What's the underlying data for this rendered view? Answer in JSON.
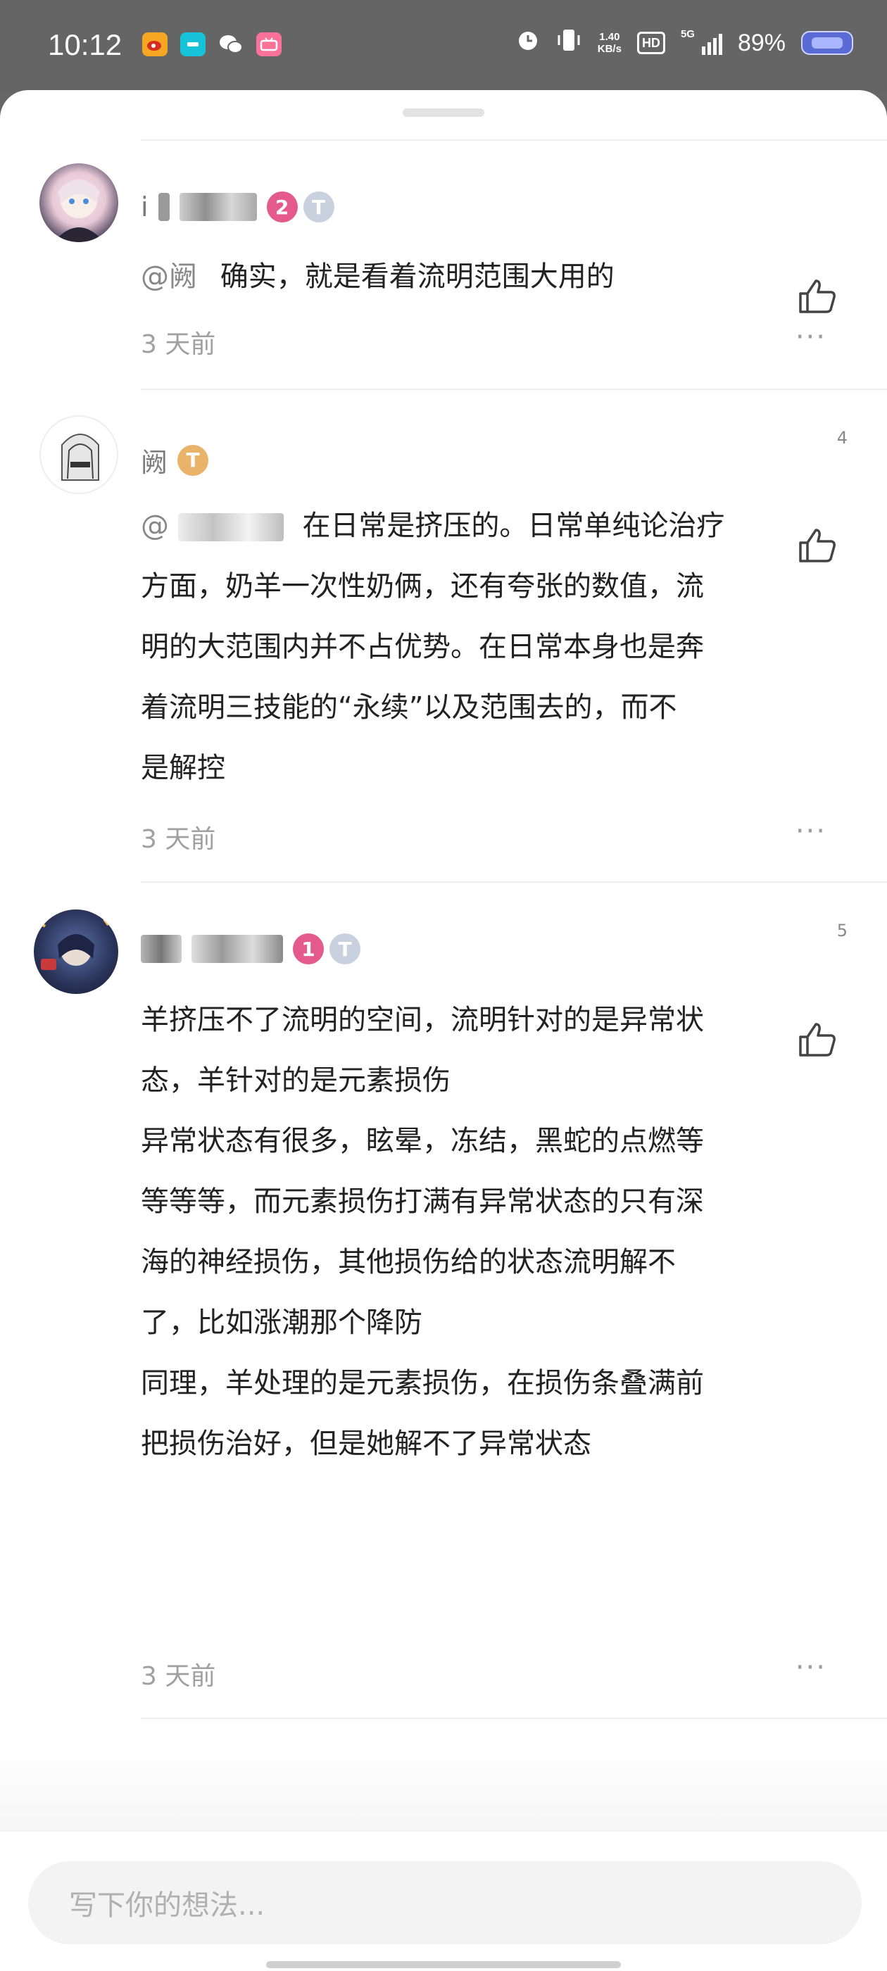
{
  "status_bar": {
    "time": "10:12",
    "app_icons": [
      "weibo-icon",
      "app-icon",
      "wechat-icon",
      "bilibili-icon"
    ],
    "net_speed_value": "1.40",
    "net_speed_unit": "KB/s",
    "hd": "HD",
    "network": "5G",
    "battery_percent": "89%"
  },
  "comments": [
    {
      "user": "i",
      "level": "2",
      "tier": "T",
      "likes": "",
      "mention": "@阙",
      "text": "确实，就是看着流明范围大用的",
      "time": "3 天前"
    },
    {
      "user": "阙",
      "level": "",
      "tier": "T",
      "likes": "4",
      "mention": "@",
      "text_lines": [
        "在日常是挤压的。日常单纯论治疗",
        "方面，奶羊一次性奶俩，还有夸张的数值，流",
        "明的大范围内并不占优势。在日常本身也是奔",
        "着流明三技能的“永续”以及范围去的，而不",
        "是解控"
      ],
      "time": "3 天前"
    },
    {
      "user": "",
      "level": "1",
      "tier": "T",
      "likes": "5",
      "text_lines": [
        "羊挤压不了流明的空间，流明针对的是异常状",
        "态，羊针对的是元素损伤",
        "异常状态有很多，眩晕，冻结，黑蛇的点燃等",
        "等等等，而元素损伤打满有异常状态的只有深",
        "海的神经损伤，其他损伤给的状态流明解不",
        "了，比如涨潮那个降防",
        "同理，羊处理的是元素损伤，在损伤条叠满前",
        "把损伤治好，但是她解不了异常状态"
      ],
      "time": "3 天前"
    }
  ],
  "input": {
    "placeholder": "写下你的想法..."
  },
  "more_label": "···",
  "colors": {
    "background_dim": "#666666",
    "sheet": "#ffffff",
    "level2": "#e35a8b",
    "level1": "#e35a8b",
    "tier": "#c9d0de",
    "tier_gold": "#e9b36a"
  }
}
